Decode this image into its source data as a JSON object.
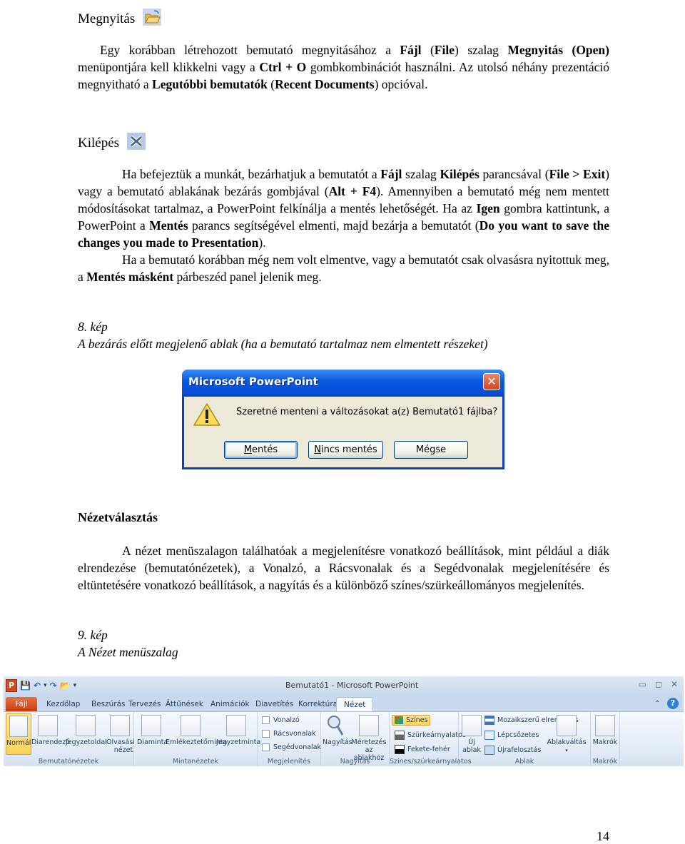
{
  "sections": {
    "open": {
      "heading": "Megnyitás",
      "icon": "open-folder-icon",
      "paragraph": [
        {
          "t": "Egy korábban létrehozott bemutató megnyitásához a ",
          "b": false
        },
        {
          "t": "Fájl",
          "b": true
        },
        {
          "t": " (",
          "b": false
        },
        {
          "t": "File",
          "b": true
        },
        {
          "t": ") szalag ",
          "b": false
        },
        {
          "t": "Megnyitás (Open)",
          "b": true
        },
        {
          "t": " menüpontjára kell klikkelni vagy a ",
          "b": false
        },
        {
          "t": "Ctrl + O",
          "b": true
        },
        {
          "t": " gombkombinációt használni. Az utolsó néhány prezentáció megnyitható a ",
          "b": false
        },
        {
          "t": "Legutóbbi bemutatók",
          "b": true
        },
        {
          "t": " (",
          "b": false
        },
        {
          "t": "Recent Documents",
          "b": true
        },
        {
          "t": ") opcióval.",
          "b": false
        }
      ]
    },
    "exit": {
      "heading": "Kilépés",
      "icon": "close-x-icon",
      "paragraph1": [
        {
          "t": "Ha befejeztük a munkát, bezárhatjuk a bemutatót a ",
          "b": false
        },
        {
          "t": "Fájl",
          "b": true
        },
        {
          "t": " szalag ",
          "b": false
        },
        {
          "t": "Kilépés",
          "b": true
        },
        {
          "t": " parancsával (",
          "b": false
        },
        {
          "t": "File > Exit",
          "b": true
        },
        {
          "t": ") vagy a bemutató ablakának bezárás gombjával (",
          "b": false
        },
        {
          "t": "Alt + F4",
          "b": true
        },
        {
          "t": "). Amennyiben a bemutató még nem mentett módosításokat tartalmaz, a PowerPoint felkínálja a mentés lehetőségét. Ha az ",
          "b": false
        },
        {
          "t": "Igen",
          "b": true
        },
        {
          "t": " gombra kattintunk, a PowerPoint a ",
          "b": false
        },
        {
          "t": "Mentés",
          "b": true
        },
        {
          "t": " parancs segítségével elmenti, majd bezárja a bemutatót (",
          "b": false
        },
        {
          "t": "Do you want to save the changes you made to Presentation",
          "b": true
        },
        {
          "t": ").",
          "b": false
        }
      ],
      "paragraph2": [
        {
          "t": "Ha a bemutató korábban még nem volt elmentve, vagy a bemutatót csak olvasásra nyitottuk meg, a ",
          "b": false
        },
        {
          "t": "Mentés másként",
          "b": true
        },
        {
          "t": " párbeszéd panel jelenik meg.",
          "b": false
        }
      ],
      "caption_number": "8. kép",
      "caption_text": "A bezárás előtt megjelenő ablak (ha a bemutató tartalmaz nem elmentett részeket)"
    },
    "view": {
      "heading": "Nézetválasztás",
      "paragraph": "A nézet menüszalagon találhatóak a megjelenítésre vonatkozó beállítások, mint például a diák elrendezése (bemutatónézetek), a Vonalzó, a Rácsvonalak és a Segédvonalak megjelenítésére és eltüntetésére vonatkozó beállítások, a nagyítás és a különböző színes/szürkeállományos megjelenítés.",
      "caption_number": "9. kép",
      "caption_text": "A Nézet menüszalag"
    }
  },
  "dialog": {
    "title": "Microsoft PowerPoint",
    "message": "Szeretné menteni a változásokat a(z) Bemutató1 fájlba?",
    "buttons": {
      "save": {
        "accel": "M",
        "rest": "entés"
      },
      "dont_save": {
        "accel": "N",
        "rest": "incs mentés"
      },
      "cancel": "Mégse"
    },
    "close_glyph": "✕",
    "colors": {
      "titlebar": "#0a5ae0",
      "body": "#ece9d8",
      "close": "#d2451d"
    }
  },
  "ribbon": {
    "window_title": "Bemutató1 - Microsoft PowerPoint",
    "qat": [
      "P",
      "💾",
      "↶",
      "▾",
      "↷",
      "📂",
      "▾"
    ],
    "window_controls": [
      "▭",
      "◻",
      "✕"
    ],
    "tabs": [
      "Fájl",
      "Kezdőlap",
      "Beszúrás",
      "Tervezés",
      "Áttűnések",
      "Animációk",
      "Diavetítés",
      "Korrektúra",
      "Nézet"
    ],
    "active_tab": "Nézet",
    "help": "?",
    "minimize_ribbon": "⌃",
    "groups": {
      "presentation_views": {
        "label": "Bemutatónézetek",
        "buttons": [
          "Normál",
          "Diarendező",
          "Jegyzetoldal",
          "Olvasási",
          "nézet"
        ]
      },
      "master_views": {
        "label": "Mintanézetek",
        "buttons": [
          "Diaminta",
          "Emlékeztetőminta",
          "Jegyzetminta"
        ]
      },
      "show": {
        "label": "Megjelenítés",
        "checkboxes": [
          "Vonalzó",
          "Rácsvonalak",
          "Segédvonalak"
        ]
      },
      "zoom": {
        "label": "Nagyítás",
        "buttons": [
          "Nagyítás",
          "Méretezés",
          "az ablakhoz"
        ]
      },
      "color": {
        "label": "Színes/szürkeárnyalatos",
        "buttons": [
          "Színes",
          "Szürkeárnyalatos",
          "Fekete-fehér"
        ]
      },
      "window": {
        "label": "Ablak",
        "new_window": [
          "Új",
          "ablak"
        ],
        "buttons": [
          "Mozaikszerű elrendezés",
          "Lépcsőzetes",
          "Újrafelosztás"
        ],
        "switch": "Ablakváltás"
      },
      "macros": {
        "label": "Makrók",
        "button": "Makrók"
      }
    }
  },
  "page_number": "14"
}
